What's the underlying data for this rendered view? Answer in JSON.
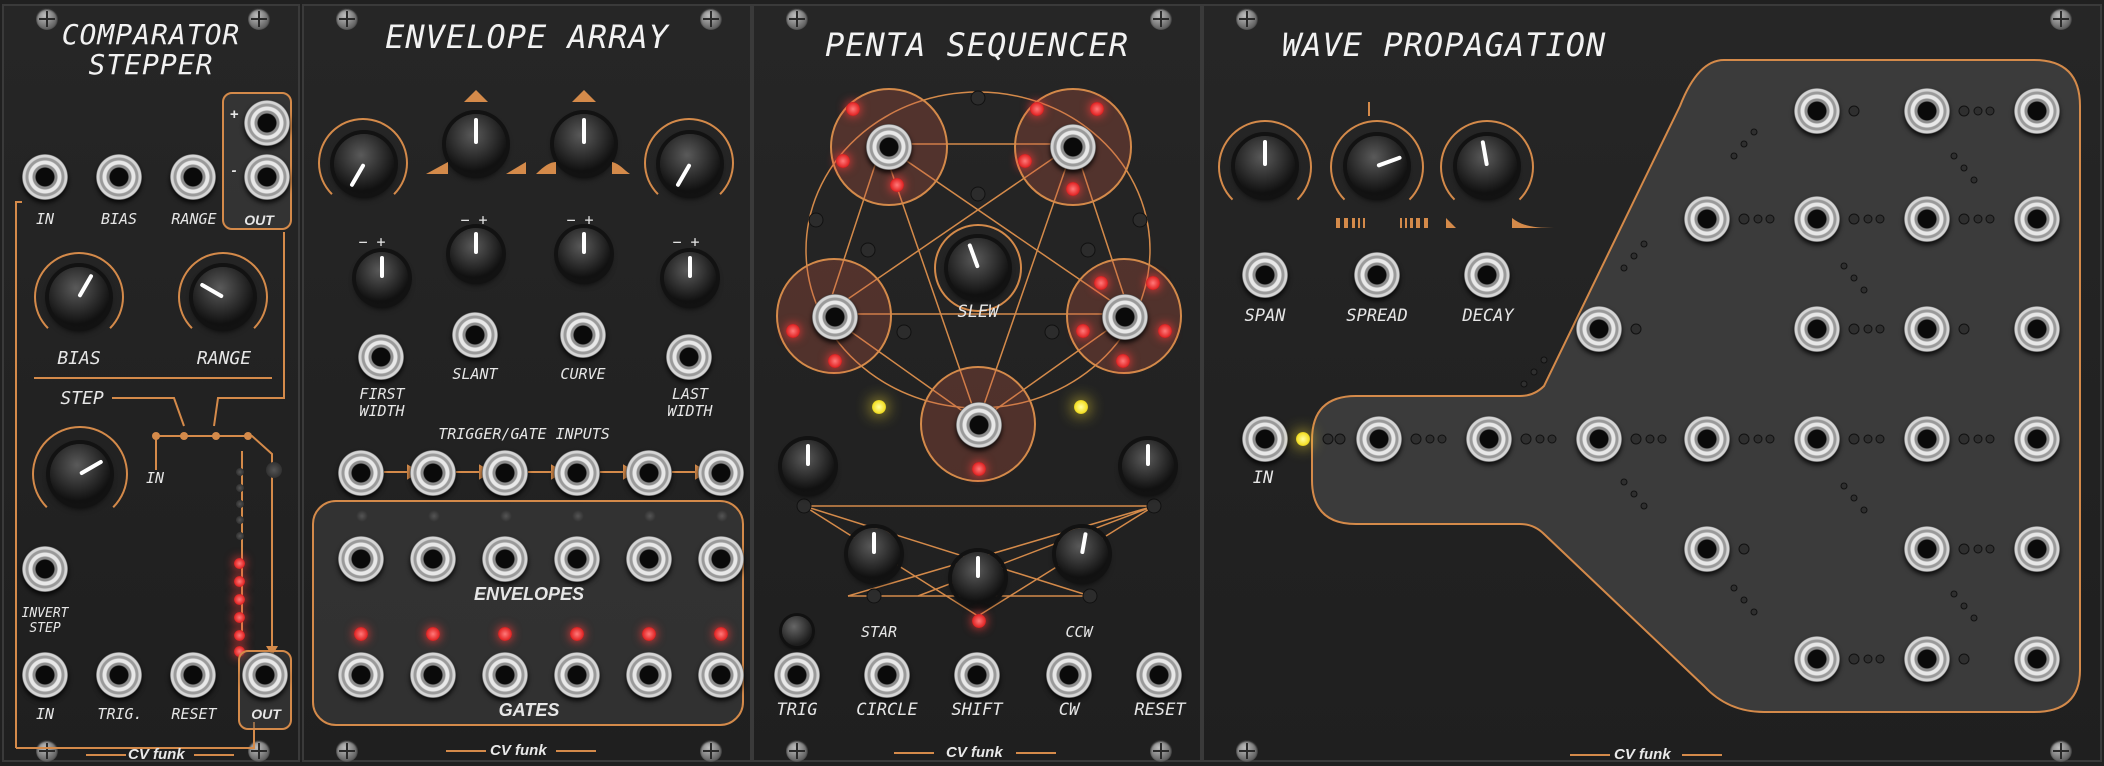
{
  "brand": "CV funk",
  "colors": {
    "accent": "#d48a4a",
    "panel": "#222222",
    "led_red": "#ff3c3c",
    "led_yellow": "#ffe433"
  },
  "comparator_stepper": {
    "title": "COMPARATOR\nSTEPPER",
    "top_labels": [
      "IN",
      "BIAS",
      "RANGE"
    ],
    "out_plus": "+",
    "out_minus": "-",
    "out_label": "OUT",
    "bias_knob_label": "BIAS",
    "range_knob_label": "RANGE",
    "step_label": "STEP",
    "in_label": "IN",
    "invert_step_label": "INVERT\nSTEP",
    "bottom_labels": [
      "IN",
      "TRIG.",
      "RESET"
    ],
    "bottom_out_label": "OUT",
    "step_leds_lit": 6,
    "step_leds_total": 11
  },
  "envelope_array": {
    "title": "ENVELOPE ARRAY",
    "jack_labels": [
      "FIRST\nWIDTH",
      "SLANT",
      "CURVE",
      "LAST\nWIDTH"
    ],
    "trigger_label": "TRIGGER/GATE INPUTS",
    "envelopes_label": "ENVELOPES",
    "gates_label": "GATES",
    "channel_count": 6
  },
  "penta_sequencer": {
    "title": "PENTA SEQUENCER",
    "slew_label": "SLEW",
    "star_label": "STAR",
    "ccw_label": "CCW",
    "bottom_labels": [
      "TRIG",
      "CIRCLE",
      "SHIFT",
      "CW",
      "RESET"
    ]
  },
  "wave_propagation": {
    "title": "WAVE PROPAGATION",
    "knob_labels": [
      "SPAN",
      "SPREAD",
      "DECAY"
    ],
    "in_label": "IN"
  }
}
